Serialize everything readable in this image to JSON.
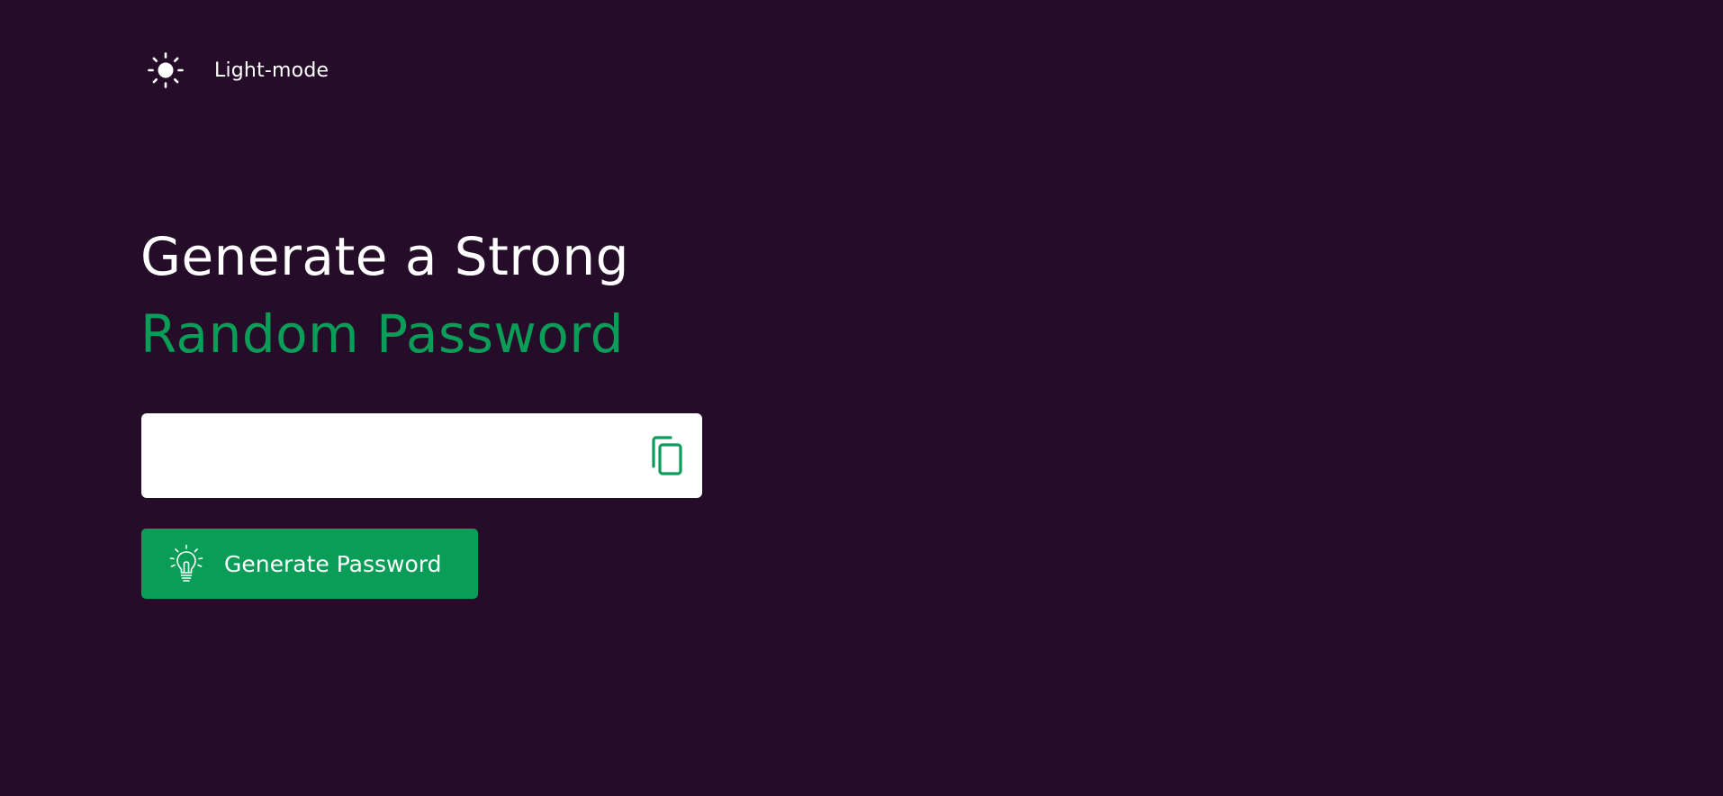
{
  "theme_toggle": {
    "label": "Light-mode",
    "icon": "sun-icon"
  },
  "headline": {
    "line1": "Generate a Strong",
    "line2": "Random Password"
  },
  "password_field": {
    "value": "",
    "placeholder": "",
    "copy_icon": "copy-icon"
  },
  "generate_button": {
    "label": "Generate Password",
    "icon": "lightbulb-icon"
  },
  "colors": {
    "background": "#250d29",
    "accent": "#0a9d57",
    "text": "#ffffff"
  }
}
